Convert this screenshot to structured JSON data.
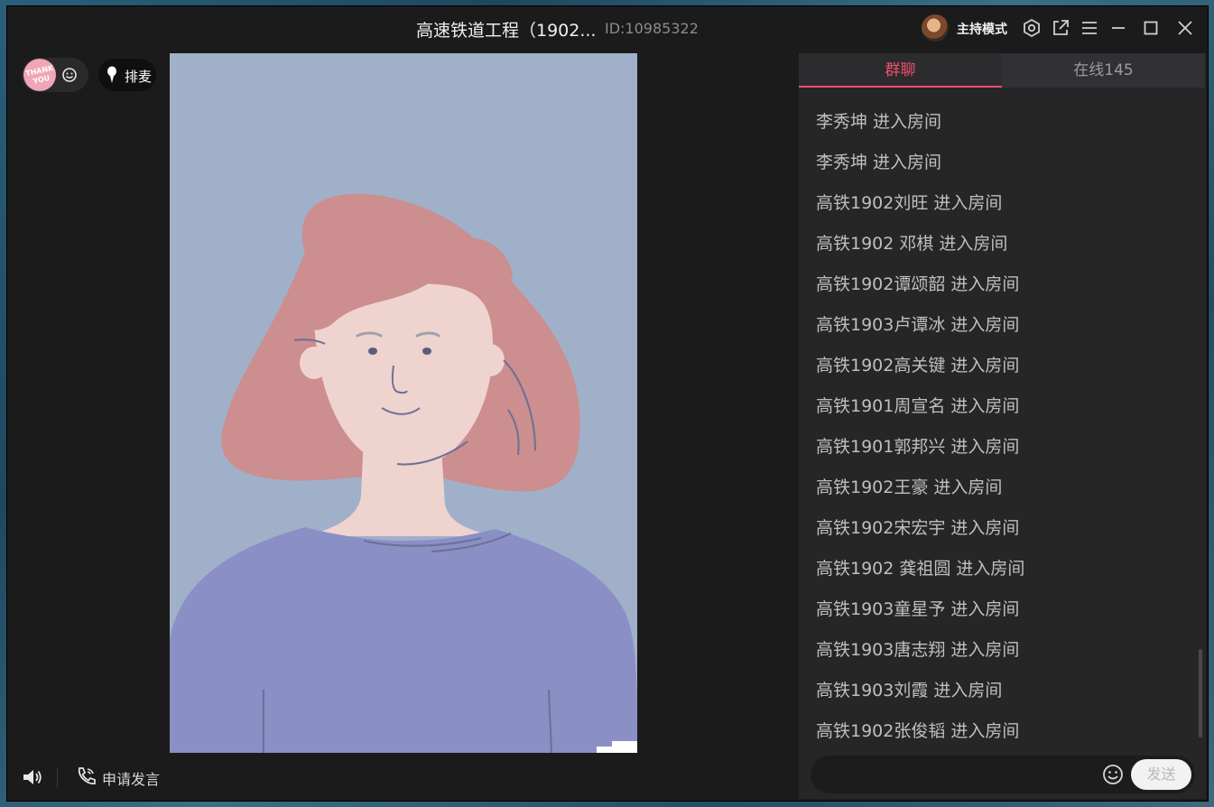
{
  "window": {
    "title": "高速铁道工程（1902...",
    "room_id": "ID:10985322",
    "host_mode_label": "主持模式",
    "icons": [
      "settings-icon",
      "popout-icon",
      "menu-icon",
      "minimize-icon",
      "maximize-icon",
      "close-icon"
    ]
  },
  "controls": {
    "thank_you_badge": "THANK YOU",
    "queue_label": "排麦",
    "apply_speak_label": "申请发言"
  },
  "panel": {
    "tabs": [
      {
        "label": "群聊",
        "active": true
      },
      {
        "label": "在线145",
        "active": false
      }
    ],
    "messages": [
      "李秀坤 进入房间",
      "李秀坤 进入房间",
      "高铁1902刘旺 进入房间",
      "高铁1902 邓棋 进入房间",
      "高铁1902谭颂韶 进入房间",
      "高铁1903卢谭冰 进入房间",
      "高铁1902高关键 进入房间",
      "高铁1901周宣名 进入房间",
      "高铁1901郭邦兴 进入房间",
      "高铁1902王豪 进入房间",
      "高铁1902宋宏宇 进入房间",
      "高铁1902 龚祖圆 进入房间",
      "高铁1903童星予 进入房间",
      "高铁1903唐志翔 进入房间",
      "高铁1903刘霞 进入房间",
      "高铁1902张俊韬 进入房间"
    ],
    "send_label": "发送"
  },
  "colors": {
    "accent": "#f0506e",
    "background": "#1b1b1c",
    "panel": "#262627"
  }
}
